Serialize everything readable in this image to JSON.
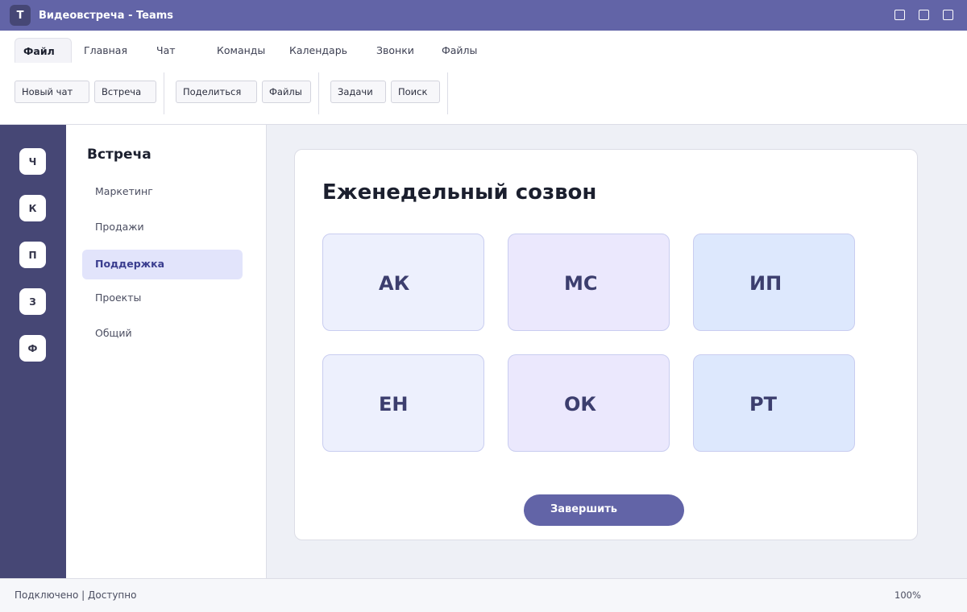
{
  "window": {
    "app_logo": "T",
    "title": "Видеовстреча - Teams",
    "controls": [
      "minimize-icon",
      "maximize-icon",
      "close-icon"
    ]
  },
  "ribbon": {
    "tabs": [
      {
        "label": "Файл",
        "active": true
      },
      {
        "label": "Главная"
      },
      {
        "label": "Чат"
      },
      {
        "label": "Команды"
      },
      {
        "label": "Календарь"
      },
      {
        "label": "Звонки"
      },
      {
        "label": "Файлы"
      }
    ],
    "buttons": [
      "Новый чат",
      "Встреча",
      "Поделиться",
      "Файлы",
      "Задачи",
      "Поиск"
    ]
  },
  "rail": {
    "items": [
      "Ч",
      "К",
      "П",
      "З",
      "Ф"
    ]
  },
  "sidebar": {
    "title": "Встреча",
    "items": [
      {
        "label": "Маркетинг"
      },
      {
        "label": "Продажи"
      },
      {
        "label": "Поддержка",
        "active": true
      },
      {
        "label": "Проекты"
      },
      {
        "label": "Общий"
      }
    ]
  },
  "meeting": {
    "title": "Еженедельный созвон",
    "participants": [
      {
        "initials": "АК",
        "color": "#edf0fd"
      },
      {
        "initials": "МС",
        "color": "#ebe8fd"
      },
      {
        "initials": "ИП",
        "color": "#dde8fd"
      },
      {
        "initials": "ЕН",
        "color": "#edf0fd"
      },
      {
        "initials": "ОК",
        "color": "#ebe8fd"
      },
      {
        "initials": "РТ",
        "color": "#dde8fd"
      }
    ],
    "end_button": "Завершить"
  },
  "statusbar": {
    "status": "Подключено | Доступно",
    "zoom": "100%"
  },
  "colors": {
    "brand": "#6264a7",
    "rail": "#464775",
    "active_item": "#e2e4fb"
  }
}
